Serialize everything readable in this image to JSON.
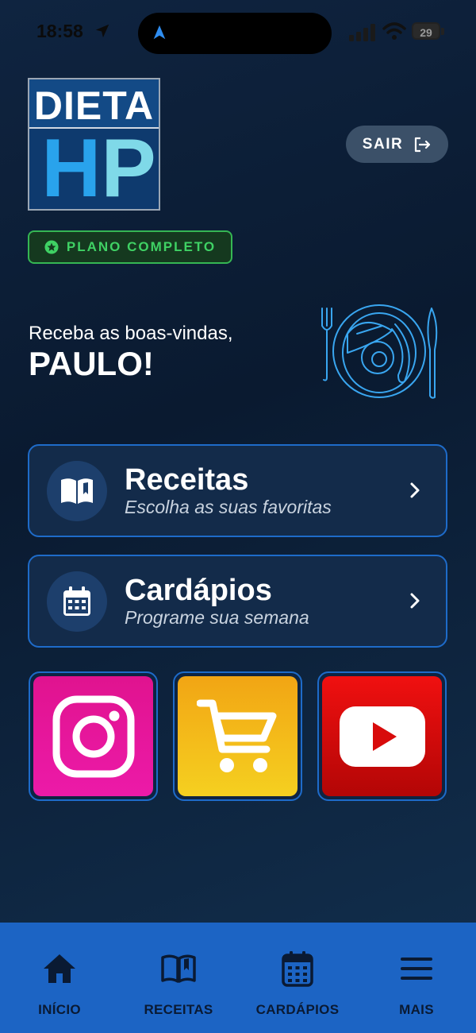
{
  "status_bar": {
    "time": "18:58",
    "battery": "29"
  },
  "logo": {
    "top_word": "DIETA",
    "big_letter_1": "H",
    "big_letter_2": "P"
  },
  "header": {
    "logout_label": "SAIR"
  },
  "plan_badge": {
    "label": "PLANO COMPLETO"
  },
  "welcome": {
    "greeting": "Receba as boas-vindas,",
    "name": "PAULO!"
  },
  "cards": [
    {
      "title": "Receitas",
      "subtitle": "Escolha as suas favoritas",
      "icon": "open-book-icon"
    },
    {
      "title": "Cardápios",
      "subtitle": "Programe sua semana",
      "icon": "calendar-icon"
    }
  ],
  "social_tiles": [
    {
      "icon": "instagram-icon",
      "color": "#e8159c"
    },
    {
      "icon": "shopping-cart-icon",
      "color": "#f3c01a"
    },
    {
      "icon": "youtube-icon",
      "color": "#e00b0b"
    }
  ],
  "bottom_nav": [
    {
      "label": "INÍCIO",
      "icon": "home-icon"
    },
    {
      "label": "RECEITAS",
      "icon": "book-icon"
    },
    {
      "label": "CARDÁPIOS",
      "icon": "calendar-icon"
    },
    {
      "label": "MAIS",
      "icon": "menu-icon"
    }
  ],
  "colors": {
    "accent_blue": "#1c64c4",
    "badge_green": "#3fd164",
    "card_border": "#1e6bc9"
  }
}
